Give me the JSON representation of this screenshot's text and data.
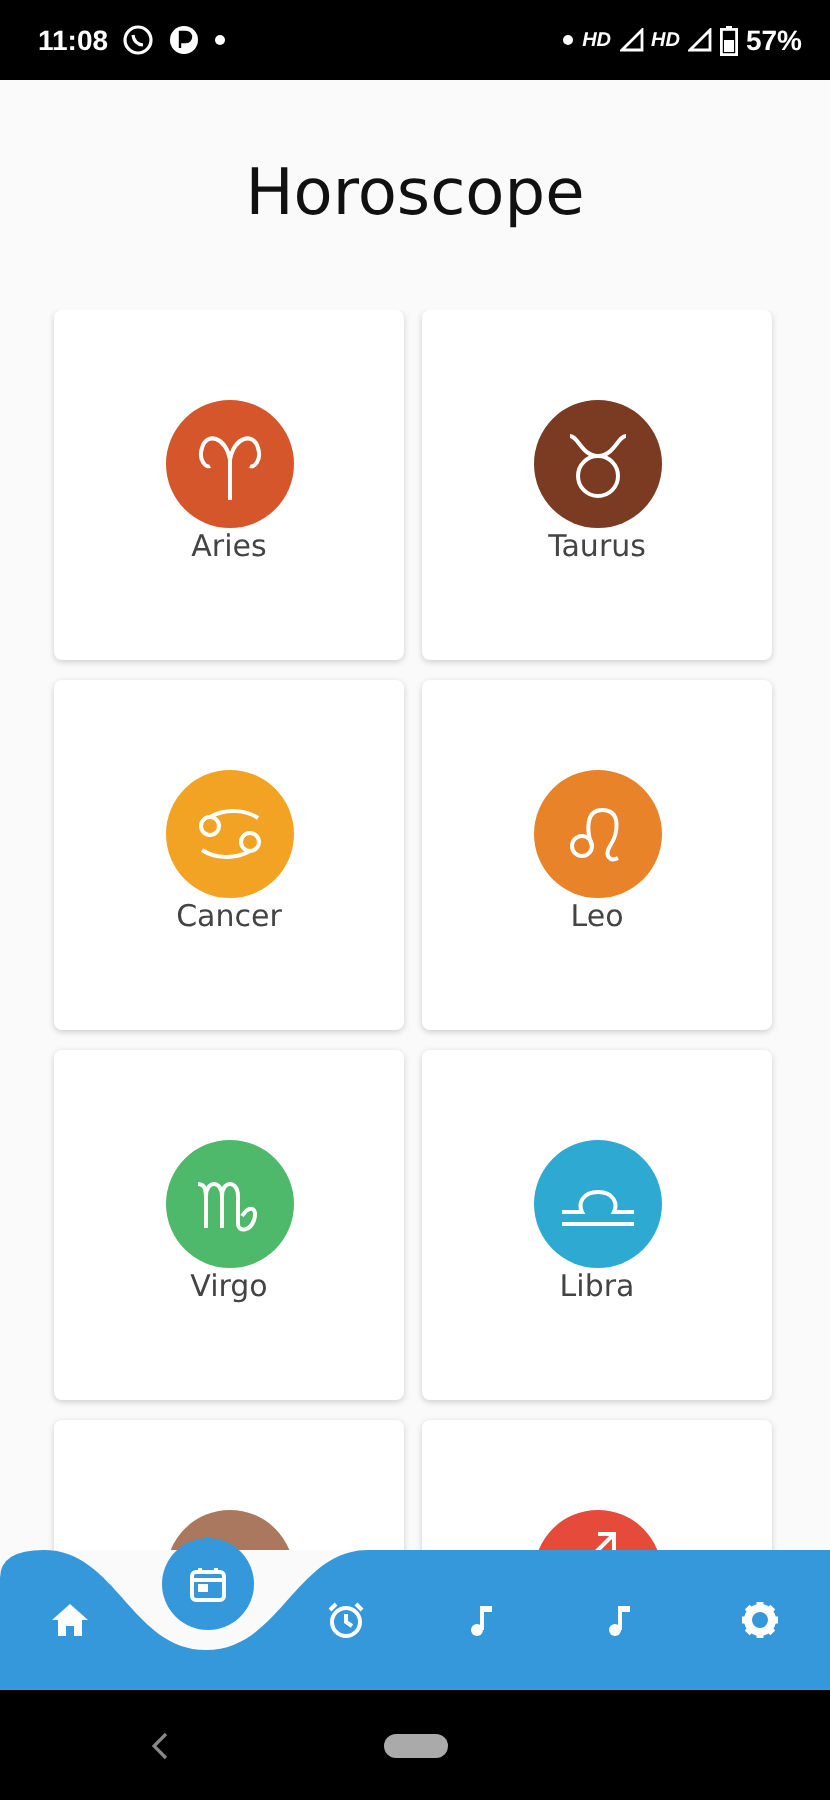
{
  "status_bar": {
    "time": "11:08",
    "network_1": "HD",
    "network_2": "HD",
    "battery": "57%"
  },
  "title": "Horoscope",
  "signs": [
    {
      "kind": "aries",
      "name": "Aries",
      "color": "#d4562a"
    },
    {
      "kind": "taurus",
      "name": "Taurus",
      "color": "#7b3a22"
    },
    {
      "kind": "cancer",
      "name": "Cancer",
      "color": "#f2a324"
    },
    {
      "kind": "leo",
      "name": "Leo",
      "color": "#e8832a"
    },
    {
      "kind": "virgo",
      "name": "Virgo",
      "color": "#4fb96b"
    },
    {
      "kind": "libra",
      "name": "Libra",
      "color": "#2ea9d2"
    },
    {
      "kind": "scorpio",
      "color": "#a9785e"
    },
    {
      "kind": "sagittarius",
      "color": "#e64a3b"
    }
  ],
  "nav": [
    {
      "kind": "home",
      "selected": false
    },
    {
      "kind": "calendar",
      "selected": true
    },
    {
      "kind": "alarm",
      "selected": false
    },
    {
      "kind": "music",
      "selected": false
    },
    {
      "kind": "music",
      "selected": false
    },
    {
      "kind": "settings",
      "selected": false
    }
  ]
}
